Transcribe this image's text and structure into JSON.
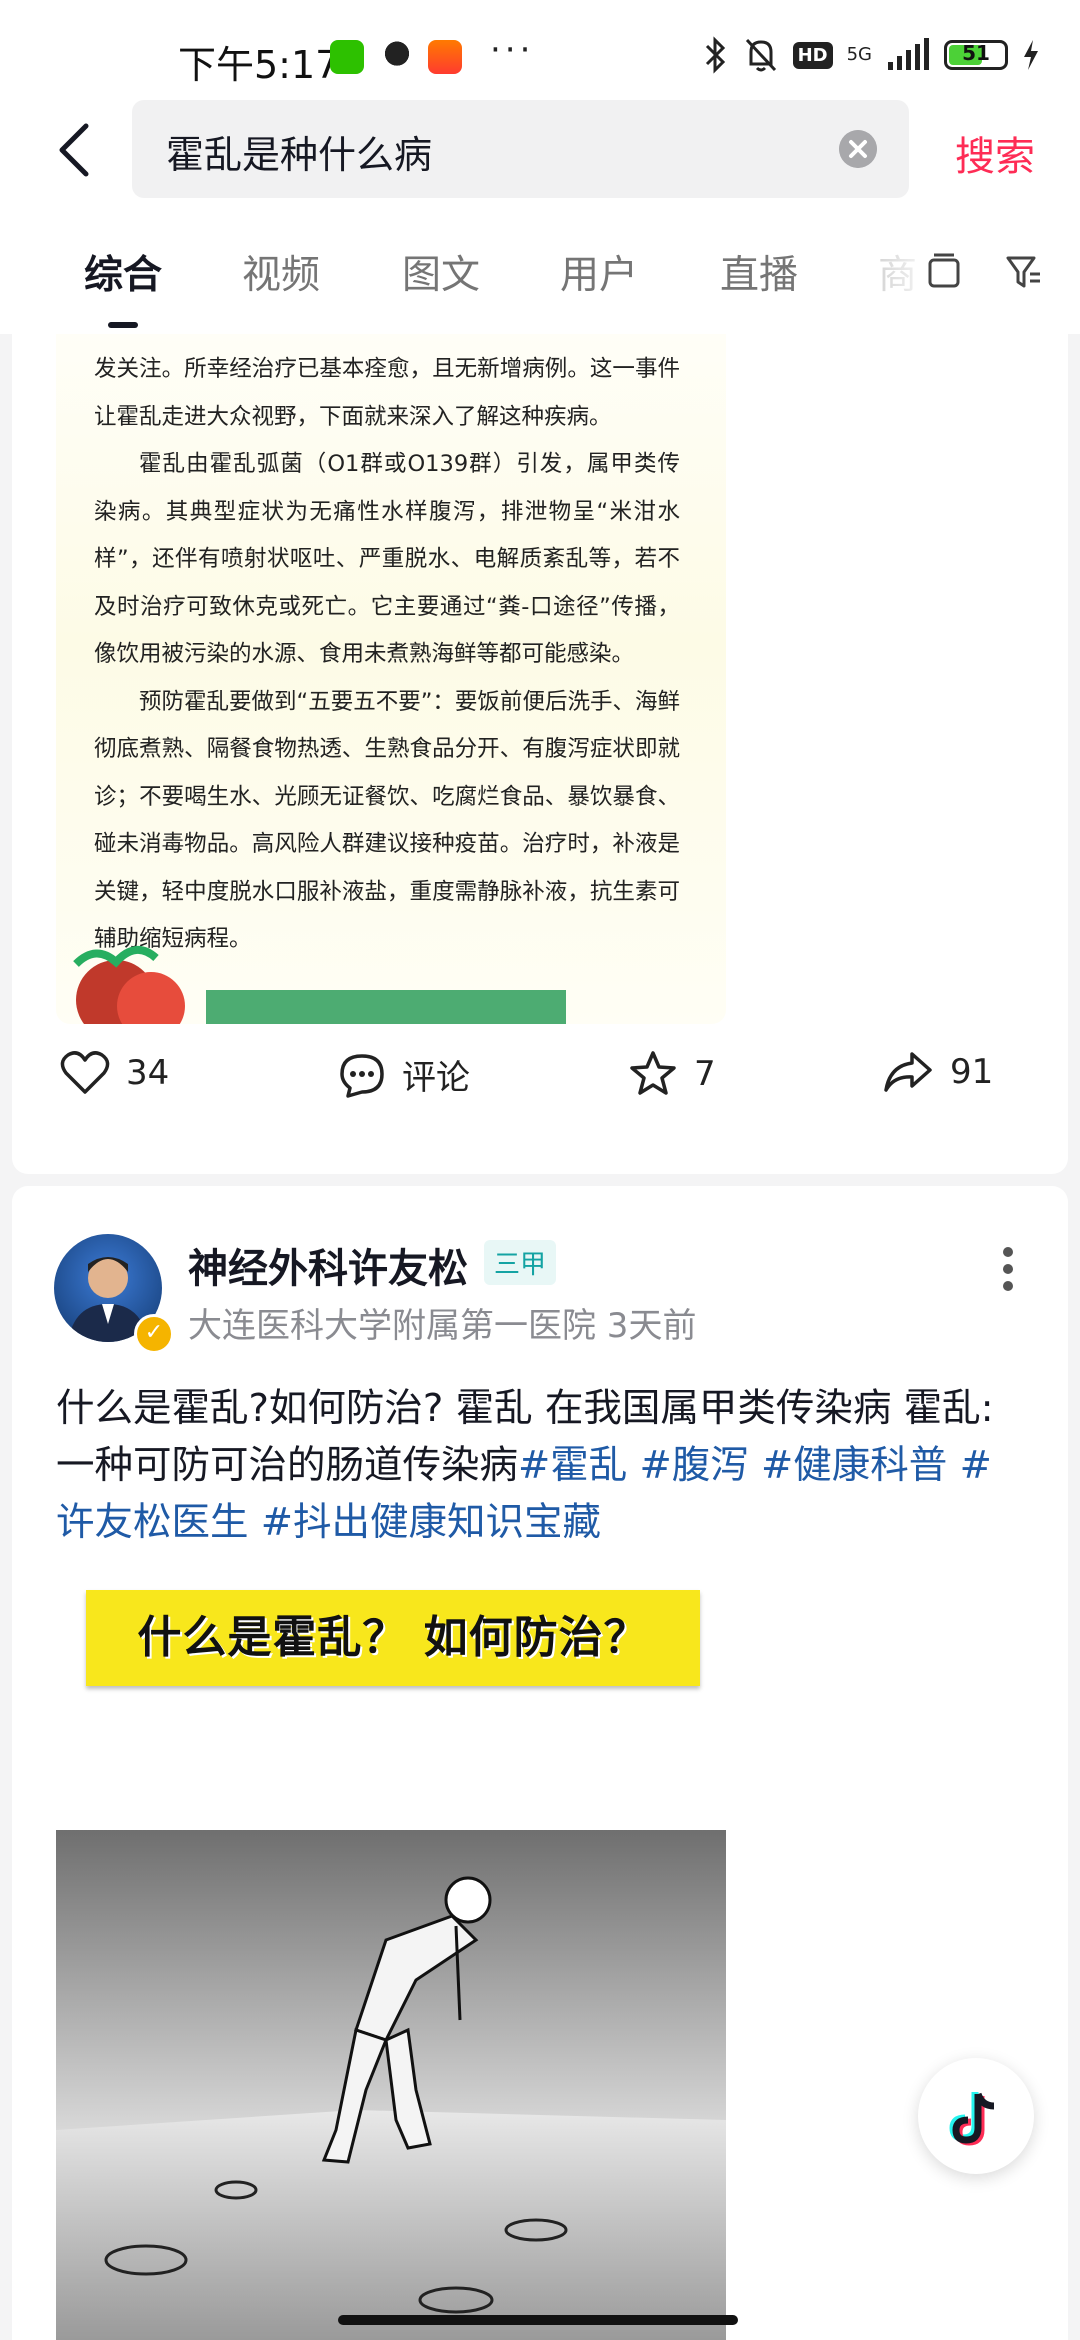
{
  "status_bar": {
    "time": "下午5:17",
    "app_icons": [
      "wechat-icon",
      "qq-icon",
      "58-icon"
    ],
    "more": "···",
    "hd_label": "HD",
    "network": "5G",
    "battery": "51"
  },
  "search": {
    "query": "霍乱是种什么病",
    "submit_label": "搜索"
  },
  "tabs": [
    {
      "label": "综合",
      "active": true
    },
    {
      "label": "视频",
      "active": false
    },
    {
      "label": "图文",
      "active": false
    },
    {
      "label": "用户",
      "active": false
    },
    {
      "label": "直播",
      "active": false
    },
    {
      "label": "商",
      "active": false
    }
  ],
  "post1": {
    "article_paragraphs": [
      "发关注。所幸经治疗已基本痊愈，且无新增病例。这一事件让霍乱走进大众视野，下面就来深入了解这种疾病。",
      "霍乱由霍乱弧菌（O1群或O139群）引发，属甲类传染病。其典型症状为无痛性水样腹泻，排泄物呈“米泔水样”，还伴有喷射状呕吐、严重脱水、电解质紊乱等，若不及时治疗可致休克或死亡。它主要通过“粪-口途径”传播，像饮用被污染的水源、食用未煮熟海鲜等都可能感染。",
      "预防霍乱要做到“五要五不要”：要饭前便后洗手、海鲜彻底煮熟、隔餐食物热透、生熟食品分开、有腹泻症状即就诊；不要喝生水、光顾无证餐饮、吃腐烂食品、暴饮暴食、碰未消毒物品。高风险人群建议接种疫苗。治疗时，补液是关键，轻中度脱水口服补液盐，重度需静脉补液，抗生素可辅助缩短病程。"
    ],
    "likes": "34",
    "comments_label": "评论",
    "favorites": "7",
    "shares": "91"
  },
  "post2": {
    "author": "神经外科许友松",
    "badge": "三甲",
    "meta": "大连医科大学附属第一医院 3天前",
    "description_text": "什么是霍乱?如何防治? 霍乱 在我国属甲类传染病 霍乱:一种可防可治的肠道传染病",
    "hashtags": [
      "#霍乱",
      "#腹泻",
      "#健康科普",
      "#许友松医生",
      "#抖出健康知识宝藏"
    ],
    "video_title": "什么是霍乱？ 如何防治？"
  },
  "colors": {
    "accent": "#fe2c55",
    "hashtag": "#1f5aa6",
    "badge": "#14a3a3",
    "video_banner": "#f8e71c"
  }
}
